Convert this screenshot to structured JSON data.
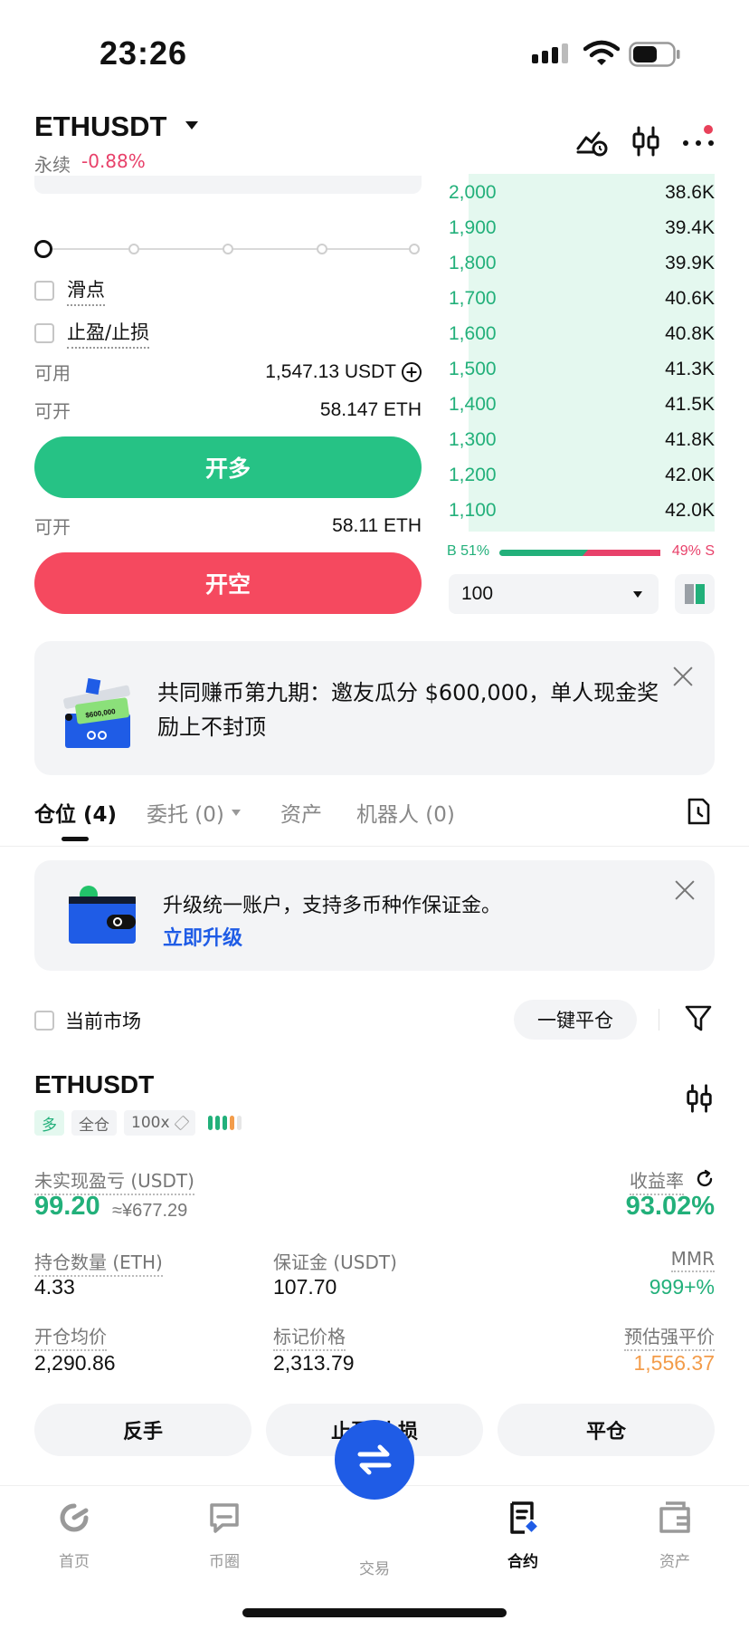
{
  "status": {
    "time": "23:26"
  },
  "header": {
    "symbol": "ETHUSDT",
    "contract_type": "永续",
    "change": "-0.88%",
    "colors": {
      "up": "#22b07a",
      "down": "#e8416a",
      "accent": "#1f5ce6"
    }
  },
  "order_form": {
    "slippage_label": "滑点",
    "tpsl_label": "止盈/止损",
    "available_label": "可用",
    "available_value": "1,547.13 USDT",
    "open_long_label": "可开",
    "open_long_value": "58.147 ETH",
    "long_button": "开多",
    "open_short_label": "可开",
    "open_short_value": "58.11 ETH",
    "short_button": "开空"
  },
  "orderbook": {
    "rows": [
      {
        "price": "2,000",
        "qty": "38.6K"
      },
      {
        "price": "1,900",
        "qty": "39.4K"
      },
      {
        "price": "1,800",
        "qty": "39.9K"
      },
      {
        "price": "1,700",
        "qty": "40.6K"
      },
      {
        "price": "1,600",
        "qty": "40.8K"
      },
      {
        "price": "1,500",
        "qty": "41.3K"
      },
      {
        "price": "1,400",
        "qty": "41.5K"
      },
      {
        "price": "1,300",
        "qty": "41.8K"
      },
      {
        "price": "1,200",
        "qty": "42.0K"
      },
      {
        "price": "1,100",
        "qty": "42.0K"
      }
    ],
    "buy_ratio": "B 51%",
    "sell_ratio": "49% S",
    "depth": "100"
  },
  "promo": {
    "text": "共同赚币第九期：邀友瓜分 $600,000，单人现金奖励上不封顶",
    "illus_amount": "$600,000"
  },
  "tabs": [
    {
      "label": "仓位 (4)"
    },
    {
      "label": "委托 (0)"
    },
    {
      "label": "资产"
    },
    {
      "label": "机器人 (0)"
    }
  ],
  "upgrade": {
    "title": "升级统一账户，支持多币种作保证金。",
    "link": "立即升级"
  },
  "filter": {
    "current_market": "当前市场",
    "close_all": "一键平仓"
  },
  "position": {
    "symbol": "ETHUSDT",
    "side_tag": "多",
    "margin_tag": "全仓",
    "leverage_tag": "100x",
    "unrealized_label": "未实现盈亏 (USDT)",
    "unrealized_value": "99.20",
    "unrealized_cny": "≈¥677.29",
    "roe_label": "收益率",
    "roe_value": "93.02%",
    "size_label": "持仓数量 (ETH)",
    "size_value": "4.33",
    "margin_label": "保证金 (USDT)",
    "margin_value": "107.70",
    "mmr_label": "MMR",
    "mmr_value": "999+%",
    "entry_label": "开仓均价",
    "entry_value": "2,290.86",
    "mark_label": "标记价格",
    "mark_value": "2,313.79",
    "liq_label": "预估强平价",
    "liq_value": "1,556.37",
    "actions": {
      "reverse": "反手",
      "tpsl": "止盈/止损",
      "close": "平仓"
    }
  },
  "nav": [
    {
      "label": "首页",
      "icon": "home-icon"
    },
    {
      "label": "币圈",
      "icon": "chat-icon"
    },
    {
      "label": "交易",
      "icon": "swap-icon"
    },
    {
      "label": "合约",
      "icon": "contract-icon"
    },
    {
      "label": "资产",
      "icon": "wallet-icon"
    }
  ]
}
